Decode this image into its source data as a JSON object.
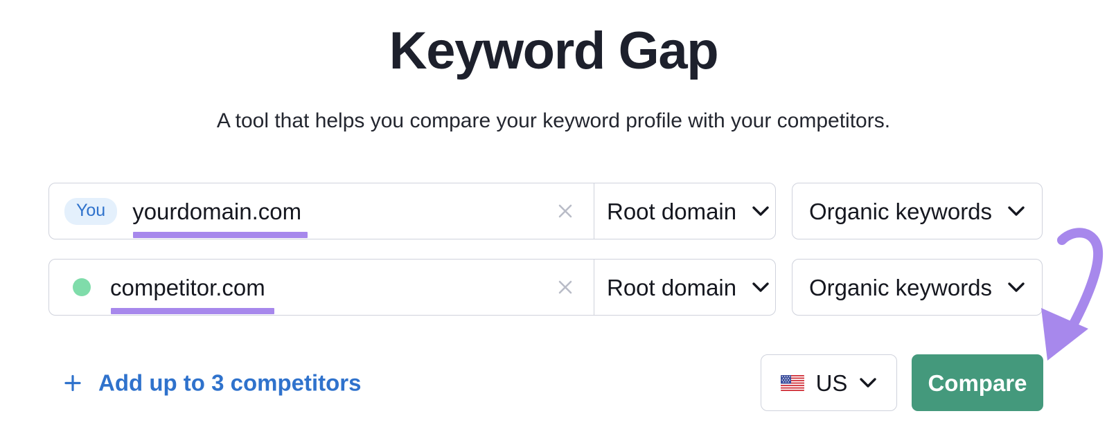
{
  "header": {
    "title": "Keyword Gap",
    "subtitle": "A tool that helps you compare your keyword profile with your competitors."
  },
  "colors": {
    "title_text": "#1d202c",
    "accent_blue": "#2f72cc",
    "badge_bg": "#e4f0fc",
    "competitor_dot": "#7fdcaa",
    "underline_purple": "#a788ec",
    "annotation_purple": "#a788ec",
    "compare_green": "#44997c",
    "border_grey": "#cfd2dc"
  },
  "rows": [
    {
      "badge_type": "you-badge",
      "badge_label": "You",
      "domain": "yourdomain.com",
      "clear_icon": "close-icon",
      "domain_type": "Root domain",
      "domain_type_chevron": "chevron-down-icon",
      "keywords_type": "Organic keywords",
      "keywords_type_chevron": "chevron-down-icon"
    },
    {
      "badge_type": "dot-badge",
      "badge_label": "",
      "domain": "competitor.com",
      "clear_icon": "close-icon",
      "domain_type": "Root domain",
      "domain_type_chevron": "chevron-down-icon",
      "keywords_type": "Organic keywords",
      "keywords_type_chevron": "chevron-down-icon"
    }
  ],
  "footer": {
    "add_competitors_icon": "plus-icon",
    "add_competitors_label": "Add up to 3 competitors",
    "country_flag_icon": "us-flag-icon",
    "country_label": "US",
    "country_chevron": "chevron-down-icon",
    "compare_label": "Compare"
  },
  "annotation": {
    "type": "curved-arrow",
    "points_to": "compare-button",
    "color": "#a788ec"
  }
}
